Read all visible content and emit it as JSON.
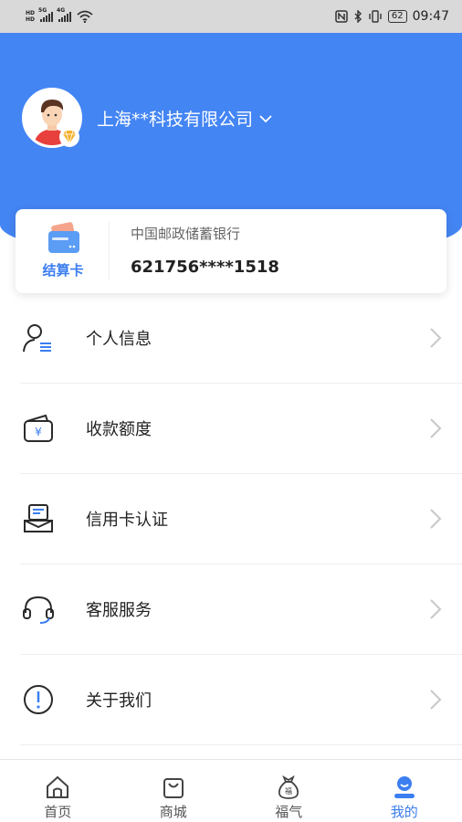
{
  "status_bar": {
    "sim1_label": "HD",
    "sim2_label": "HD",
    "network1": "5G",
    "network2": "4G",
    "battery": "62",
    "time": "09:47"
  },
  "header": {
    "company_name": "上海**科技有限公司"
  },
  "bank_card": {
    "type_label": "结算卡",
    "bank_name": "中国邮政储蓄银行",
    "card_number": "621756****1518"
  },
  "menu": [
    {
      "label": "个人信息",
      "icon": "user-info-icon"
    },
    {
      "label": "收款额度",
      "icon": "wallet-icon"
    },
    {
      "label": "信用卡认证",
      "icon": "credit-card-icon"
    },
    {
      "label": "客服服务",
      "icon": "headset-icon"
    },
    {
      "label": "关于我们",
      "icon": "info-icon"
    }
  ],
  "tab_bar": {
    "tabs": [
      {
        "label": "首页",
        "icon": "home-icon",
        "active": false
      },
      {
        "label": "商城",
        "icon": "shopping-bag-icon",
        "active": false
      },
      {
        "label": "福气",
        "icon": "fortune-bag-icon",
        "active": false
      },
      {
        "label": "我的",
        "icon": "profile-icon",
        "active": true
      }
    ]
  },
  "colors": {
    "primary": "#4485f4",
    "accent_text": "#3b7ef0"
  }
}
